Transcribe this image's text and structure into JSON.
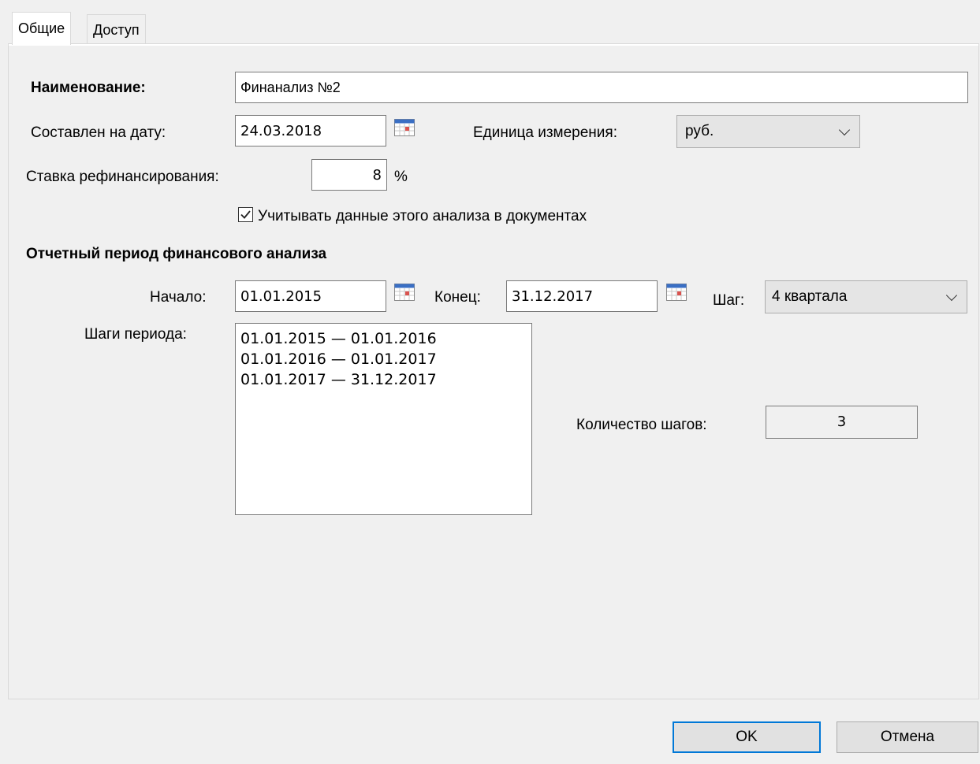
{
  "tabs": [
    {
      "label": "Общие"
    },
    {
      "label": "Доступ"
    }
  ],
  "form": {
    "name_label": "Наименование:",
    "name_value": "Финанализ №2",
    "date_label": "Составлен на дату:",
    "date_value": "24.03.2018",
    "unit_label": "Единица измерения:",
    "unit_value": "руб.",
    "rate_label": "Ставка рефинансирования:",
    "rate_value": "8",
    "rate_unit": "%",
    "use_in_docs_label": "Учитывать данные этого анализа в документах",
    "use_in_docs_checked": true
  },
  "period": {
    "section_title": "Отчетный период финансового анализа",
    "start_label": "Начало:",
    "start_value": "01.01.2015",
    "end_label": "Конец:",
    "end_value": "31.12.2017",
    "step_label": "Шаг:",
    "step_value": "4 квартала",
    "steps_label": "Шаги периода:",
    "steps": [
      "01.01.2015 — 01.01.2016",
      "01.01.2016 — 01.01.2017",
      "01.01.2017 — 31.12.2017"
    ],
    "count_label": "Количество шагов:",
    "count_value": "3"
  },
  "buttons": {
    "ok_label": "OK",
    "cancel_label": "Отмена"
  },
  "icons": {
    "calendar": "calendar-icon",
    "dropdown": "chevron-down-icon",
    "checkbox": "checkmark-icon"
  },
  "colors": {
    "accent": "#0078d7",
    "window_bg": "#f0f0f0"
  }
}
